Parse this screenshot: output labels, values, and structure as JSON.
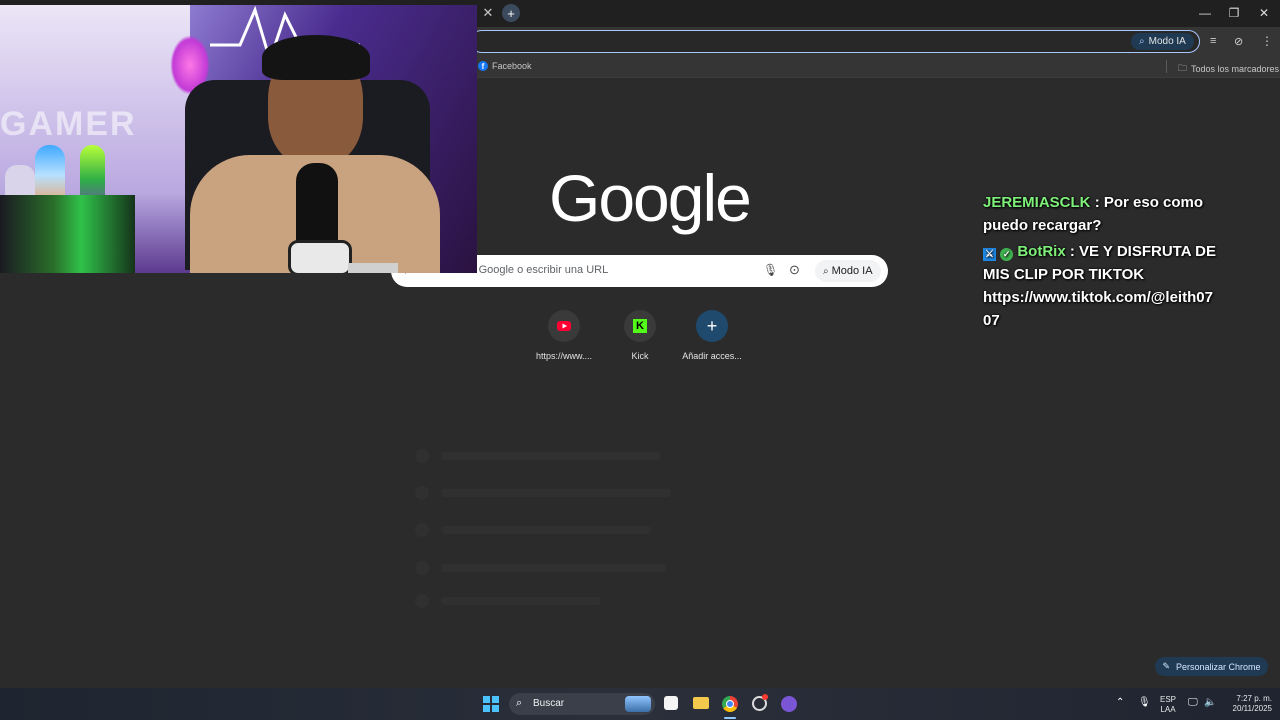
{
  "browser": {
    "ai_mode_label": "Modo IA",
    "bookmark_facebook": "Facebook",
    "all_bookmarks": "Todos los marcadores"
  },
  "ntp": {
    "logo": "Google",
    "search_placeholder": "Buscar en Google o escribir una URL",
    "ai_mode_label": "Modo IA",
    "shortcuts": [
      {
        "label": "https://www....",
        "icon": "youtube-icon"
      },
      {
        "label": "Kick",
        "icon": "kick-icon"
      },
      {
        "label": "Añadir acces...",
        "icon": "plus-icon"
      }
    ],
    "customize_label": "Personalizar Chrome"
  },
  "chat": {
    "messages": [
      {
        "user": "JEREMIASCLK",
        "text": ": Por eso como puedo recargar?"
      },
      {
        "user": "BotRix",
        "text": ": VE Y DISFRUTA DE MIS CLIP POR TIKTOK https://www.tiktok.com/@leith07 07",
        "badges": [
          "mod-sword-icon",
          "verified-check-icon"
        ]
      }
    ]
  },
  "webcam": {
    "neon_sign": "GAMER"
  },
  "taskbar": {
    "search_label": "Buscar",
    "lang_line1": "ESP",
    "lang_line2": "LAA",
    "time": "7:27 p. m.",
    "date": "20/11/2025"
  },
  "colors": {
    "accent": "#a8c7fa",
    "chat_username": "#7ef07a",
    "youtube_red": "#ff0033",
    "kick_green": "#53fc18"
  }
}
